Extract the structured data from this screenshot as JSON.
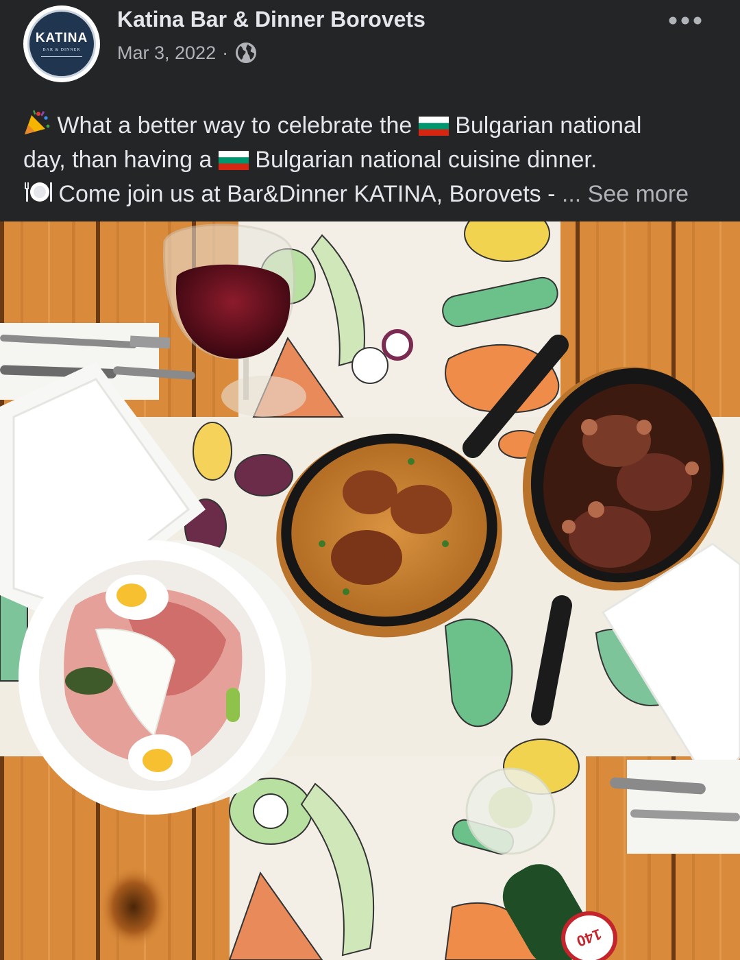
{
  "post": {
    "page_name": "Katina Bar & Dinner Borovets",
    "date": "Mar 3, 2022",
    "audience_icon": "globe-icon",
    "more_icon": "more-horizontal-icon",
    "avatar": {
      "logo_text": "KATINA",
      "logo_subtext": "BAR & DINNER"
    },
    "text": {
      "line1": "What a better way to celebrate the",
      "line1b": "Bulgarian national",
      "line2a": "day, than having a",
      "line2b": "Bulgarian national cuisine dinner.",
      "line3": "Come join us at Bar&Dinner KATINA, Borovets -  ",
      "ellipsis": "...",
      "see_more": "See more"
    },
    "emoji_icons": [
      "party-popper-icon",
      "bulgaria-flag-icon",
      "bulgaria-flag-icon",
      "plate-cutlery-icon"
    ],
    "photo": {
      "beer_cap_label": "140"
    }
  },
  "colors": {
    "background": "#242526",
    "text_primary": "#e4e6eb",
    "text_secondary": "#b0b3b8"
  }
}
